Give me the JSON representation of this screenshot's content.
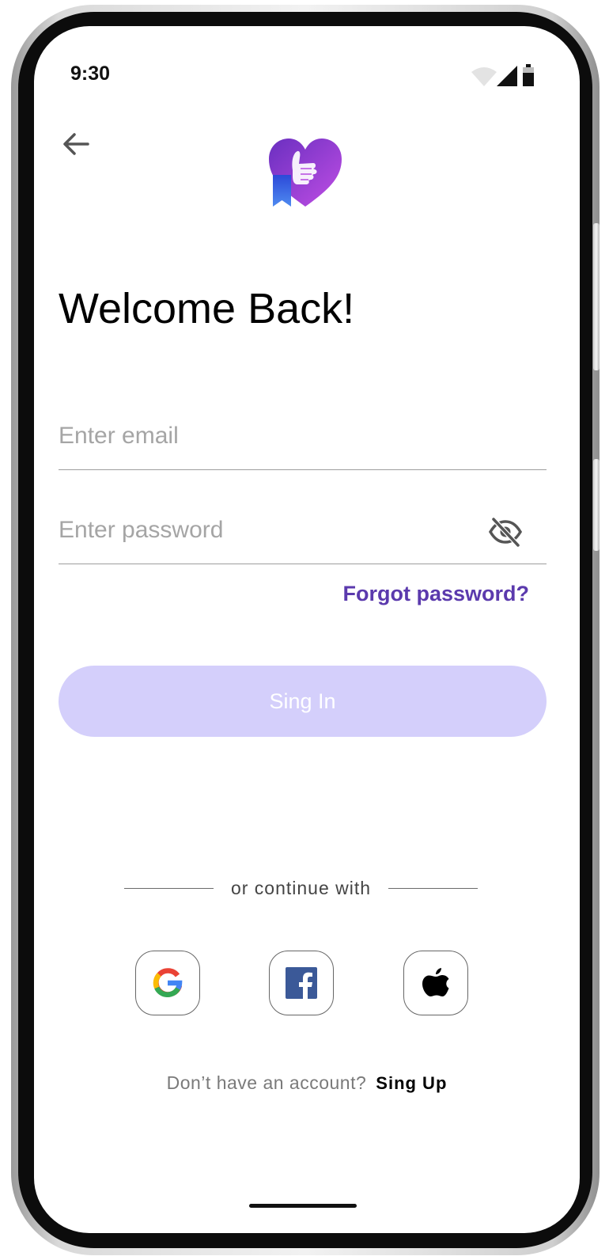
{
  "status_bar": {
    "time": "9:30",
    "icons": [
      "wifi-icon",
      "cellular-signal-icon",
      "battery-icon"
    ]
  },
  "header": {
    "back_icon": "arrow-left-icon",
    "logo": "heart-thumbs-up-logo"
  },
  "title": "Welcome Back!",
  "form": {
    "email": {
      "value": "",
      "placeholder": "Enter email"
    },
    "password": {
      "value": "",
      "placeholder": "Enter password",
      "toggle_icon": "eye-off-icon"
    },
    "forgot_label": "Forgot password?",
    "submit_label": "Sing In"
  },
  "social": {
    "divider_text": "or continue with",
    "providers": [
      "google-icon",
      "facebook-icon",
      "apple-icon"
    ]
  },
  "footer": {
    "prompt": "Don’t have an account?",
    "link": "Sing Up"
  },
  "colors": {
    "accent": "#5b3aad",
    "button_disabled": "#d4cffb",
    "logo_gradient_start": "#6a2fc0",
    "logo_gradient_end": "#b94ae0"
  }
}
